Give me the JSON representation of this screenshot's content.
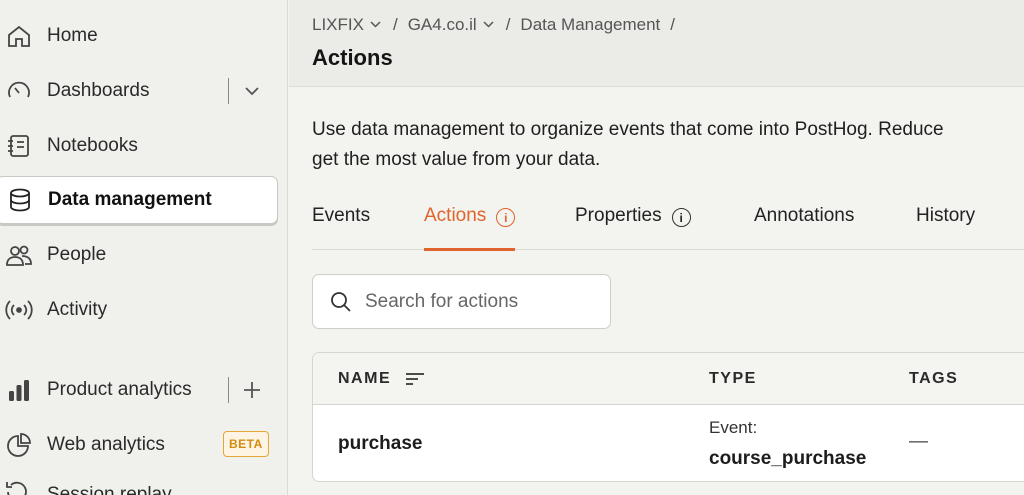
{
  "sidebar": {
    "items": [
      {
        "label": "Home",
        "icon": "home-icon"
      },
      {
        "label": "Dashboards",
        "icon": "gauge-icon"
      },
      {
        "label": "Notebooks",
        "icon": "notebook-icon"
      },
      {
        "label": "Data management",
        "icon": "database-icon"
      },
      {
        "label": "People",
        "icon": "people-icon"
      },
      {
        "label": "Activity",
        "icon": "broadcast-icon"
      },
      {
        "label": "Product analytics",
        "icon": "bar-chart-icon"
      },
      {
        "label": "Web analytics",
        "icon": "pie-chart-icon",
        "badge": "BETA"
      }
    ],
    "partial_item": "Session replay"
  },
  "breadcrumb": {
    "org": "LIXFIX",
    "project": "GA4.co.il",
    "section": "Data Management",
    "separator": "/"
  },
  "page": {
    "title": "Actions",
    "description_line1": "Use data management to organize events that come into PostHog. Reduce",
    "description_line2": "get the most value from your data."
  },
  "tabs": [
    {
      "label": "Events",
      "active": false,
      "info": false
    },
    {
      "label": "Actions",
      "active": true,
      "info": true
    },
    {
      "label": "Properties",
      "active": false,
      "info": true
    },
    {
      "label": "Annotations",
      "active": false,
      "info": false
    },
    {
      "label": "History",
      "active": false,
      "info": false
    }
  ],
  "search": {
    "placeholder": "Search for actions",
    "value": ""
  },
  "table": {
    "headers": {
      "name": "NAME",
      "type": "TYPE",
      "tags": "TAGS"
    },
    "rows": [
      {
        "name": "purchase",
        "type_label": "Event:",
        "type_value": "course_purchase",
        "tags": "—"
      }
    ]
  },
  "colors": {
    "accent": "#e0642c",
    "beta_badge": "#d38b12"
  }
}
